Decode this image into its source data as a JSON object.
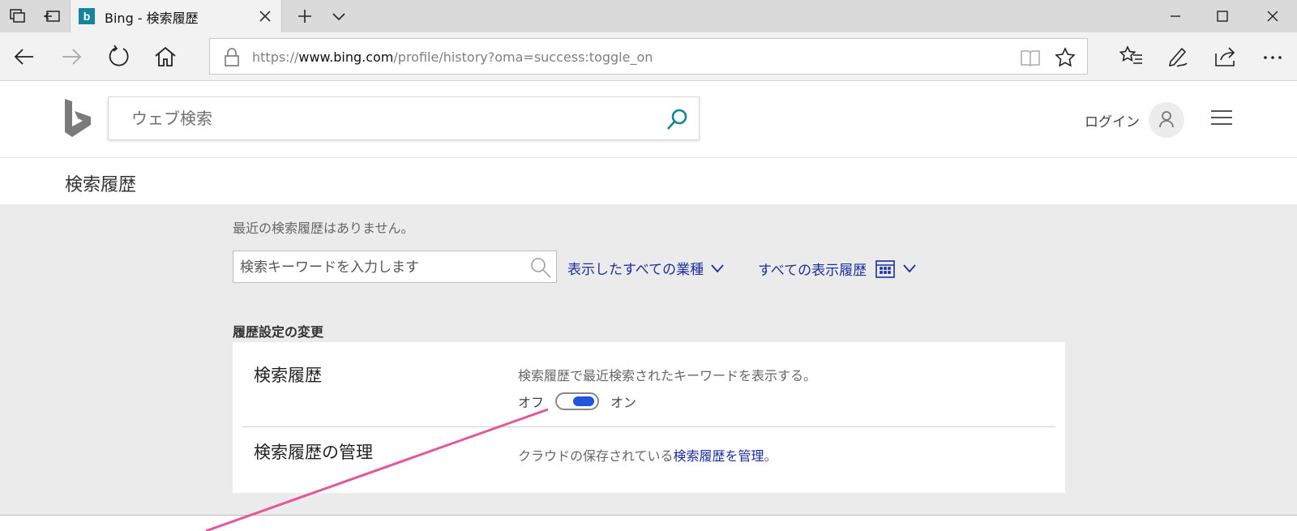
{
  "browser": {
    "tab": {
      "favicon": "b",
      "title": "Bing - 検索履歴"
    },
    "address": {
      "scheme": "https://",
      "domain": "www.bing.com",
      "path": "/profile/history?oma=success:toggle_on"
    }
  },
  "header": {
    "search_placeholder": "ウェブ検索",
    "login_label": "ログイン"
  },
  "page": {
    "title": "検索履歴",
    "empty_message": "最近の検索履歴はありません。",
    "filter_placeholder": "検索キーワードを入力します",
    "dropdowns": [
      {
        "label": "表示したすべての業種"
      },
      {
        "label": "すべての表示履歴"
      }
    ]
  },
  "settings": {
    "heading": "履歴設定の変更",
    "search_history": {
      "label": "検索履歴",
      "description": "検索履歴で最近検索されたキーワードを表示する。",
      "off_label": "オフ",
      "on_label": "オン",
      "toggle_state": "on"
    },
    "manage": {
      "label": "検索履歴の管理",
      "description_prefix": "クラウドの保存されている",
      "link_text": "検索履歴を管理",
      "description_suffix": "。"
    }
  },
  "colors": {
    "link": "#1a2ea0",
    "toggle_on": "#2255dd",
    "bing_teal": "#13859c",
    "annotation": "#e2589a"
  }
}
